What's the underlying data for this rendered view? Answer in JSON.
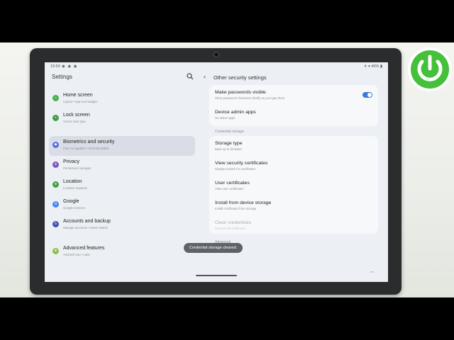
{
  "colors": {
    "accent": "#3a7bd5",
    "screen_bg": "#ecf0f4",
    "card_bg": "#f7f8fa",
    "logo_green": "#44c03a"
  },
  "status_bar": {
    "time": "19:50",
    "icons": "◉ ◉ ◉ ·",
    "right": "✈ ▾ 46% ▮"
  },
  "left_pane": {
    "title": "Settings",
    "search_icon": "search-icon",
    "items": [
      {
        "title": "Home screen",
        "subtitle": "Layout  •  App icon badges",
        "icon": "home-icon",
        "color": "#4caf50",
        "active": false
      },
      {
        "title": "Lock screen",
        "subtitle": "Screen lock type",
        "icon": "lock-icon",
        "color": "#43a047",
        "active": false
      },
      {
        "title": "Biometrics and security",
        "subtitle": "Face recognition  •  Find My Mobile",
        "icon": "shield-icon",
        "color": "#5b6ee1",
        "active": true
      },
      {
        "title": "Privacy",
        "subtitle": "Permission manager",
        "icon": "privacy-icon",
        "color": "#7e57c2",
        "active": false
      },
      {
        "title": "Location",
        "subtitle": "Location requests",
        "icon": "location-icon",
        "color": "#43a047",
        "active": false
      },
      {
        "title": "Google",
        "subtitle": "Google services",
        "icon": "google-icon",
        "color": "#4285f4",
        "active": false
      },
      {
        "title": "Accounts and backup",
        "subtitle": "Manage accounts  •  Smart Switch",
        "icon": "sync-icon",
        "color": "#3f51b5",
        "active": false
      },
      {
        "title": "Advanced features",
        "subtitle": "Android Auto  •  Labs",
        "icon": "star-icon",
        "color": "#8bc34a",
        "active": false
      }
    ]
  },
  "right_pane": {
    "title": "Other security settings",
    "card1": [
      {
        "title": "Make passwords visible",
        "subtitle": "Show password characters briefly as you type them",
        "toggle": true
      },
      {
        "title": "Device admin apps",
        "subtitle": "No active apps"
      }
    ],
    "section_credential": "Credential storage",
    "card2": [
      {
        "title": "Storage type",
        "subtitle": "Back up to firmware"
      },
      {
        "title": "View security certificates",
        "subtitle": "Display trusted CA certificates"
      },
      {
        "title": "User certificates",
        "subtitle": "View user certificates"
      },
      {
        "title": "Install from device storage",
        "subtitle": "Install certificates from storage"
      },
      {
        "title": "Clear credentials",
        "subtitle": "Remove all certificates",
        "disabled": true
      }
    ],
    "section_advanced": "Advanced"
  },
  "toast": "Credential storage cleared."
}
